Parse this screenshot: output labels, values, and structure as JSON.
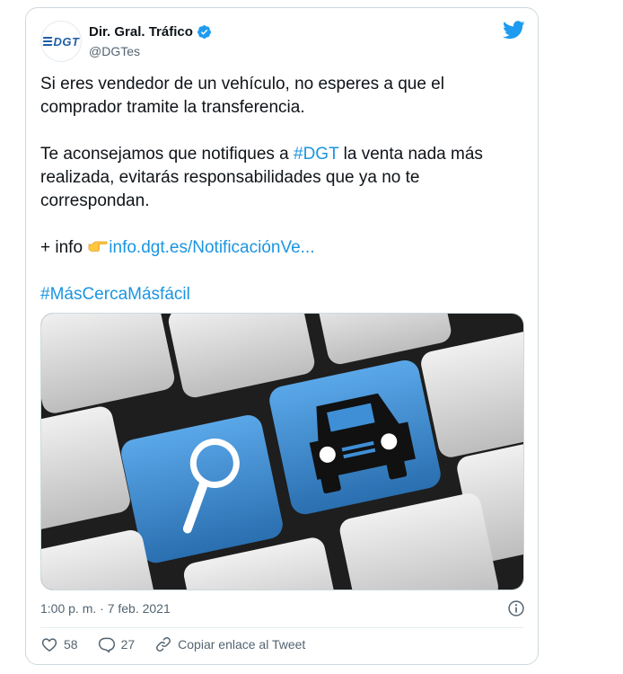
{
  "author": {
    "display_name": "Dir. Gral. Tráfico",
    "handle": "@DGTes",
    "logo_text": "DGT"
  },
  "tweet": {
    "para1": "Si eres vendedor de un vehículo, no esperes a que el comprador tramite la transferencia.",
    "para2_before": "Te aconsejamos que notifiques a ",
    "para2_hashtag": "#DGT",
    "para2_after": " la venta nada más realizada, evitarás responsabilidades que ya no te correspondan.",
    "para3_prefix": "+ info ",
    "para3_link": "info.dgt.es/NotificaciónVe...",
    "hashtag": "#MásCercaMásfácil"
  },
  "timestamp": "1:00 p. m. · 7 feb. 2021",
  "actions": {
    "likes": "58",
    "replies": "27",
    "copy_link": "Copiar enlace al Tweet"
  },
  "colors": {
    "link": "#1b95e0",
    "key_blue": "#3f8fd6",
    "key_gray": "#d9d9d9"
  },
  "icons": [
    "dgt-logo",
    "verified-icon",
    "twitter-bird-icon",
    "pointing-hand-emoji",
    "magnifier-icon",
    "car-icon",
    "info-icon",
    "heart-icon",
    "reply-icon",
    "link-icon"
  ]
}
